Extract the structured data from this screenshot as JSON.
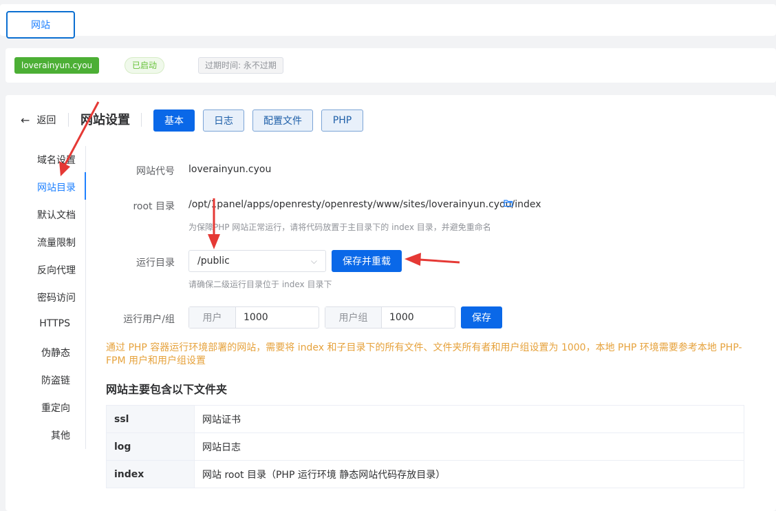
{
  "top_tabs": [
    {
      "label": "网站"
    }
  ],
  "status_bar": {
    "domain": "loverainyun.cyou",
    "status": "已启动",
    "expire": "过期时间: 永不过期"
  },
  "header": {
    "back_label": "返回",
    "title": "网站设置",
    "tabs": [
      {
        "label": "基本",
        "active": true
      },
      {
        "label": "日志",
        "active": false
      },
      {
        "label": "配置文件",
        "active": false
      },
      {
        "label": "PHP",
        "active": false
      }
    ]
  },
  "sidebar": {
    "items": [
      {
        "label": "域名设置"
      },
      {
        "label": "网站目录",
        "active": true
      },
      {
        "label": "默认文档"
      },
      {
        "label": "流量限制"
      },
      {
        "label": "反向代理"
      },
      {
        "label": "密码访问"
      },
      {
        "label": "HTTPS"
      },
      {
        "label": "伪静态"
      },
      {
        "label": "防盗链"
      },
      {
        "label": "重定向"
      },
      {
        "label": "其他"
      }
    ]
  },
  "form": {
    "site_code_label": "网站代号",
    "site_code_value": "loverainyun.cyou",
    "root_label": "root 目录",
    "root_value": "/opt/1panel/apps/openresty/openresty/www/sites/loverainyun.cyou/index",
    "root_hint": "为保障PHP 网站正常运行，请将代码放置于主目录下的 index 目录，并避免重命名",
    "run_dir_label": "运行目录",
    "run_dir_value": "/public",
    "save_reload_label": "保存并重载",
    "run_dir_hint": "请确保二级运行目录位于 index 目录下",
    "run_user_label": "运行用户/组",
    "user_prefix": "用户",
    "user_value": "1000",
    "group_prefix": "用户组",
    "group_value": "1000",
    "save_label": "保存"
  },
  "warning": "通过 PHP 容器运行环境部署的网站，需要将 index 和子目录下的所有文件、文件夹所有者和用户组设置为 1000，本地 PHP 环境需要参考本地 PHP-FPM 用户和用户组设置",
  "folders": {
    "title": "网站主要包含以下文件夹",
    "rows": [
      {
        "name": "ssl",
        "desc": "网站证书"
      },
      {
        "name": "log",
        "desc": "网站日志"
      },
      {
        "name": "index",
        "desc": "网站 root 目录（PHP 运行环境 静态网站代码存放目录）"
      }
    ]
  },
  "colors": {
    "primary": "#0a68e8",
    "success": "#4caf35",
    "warning": "#e6a23c",
    "annotation": "#e53935"
  }
}
